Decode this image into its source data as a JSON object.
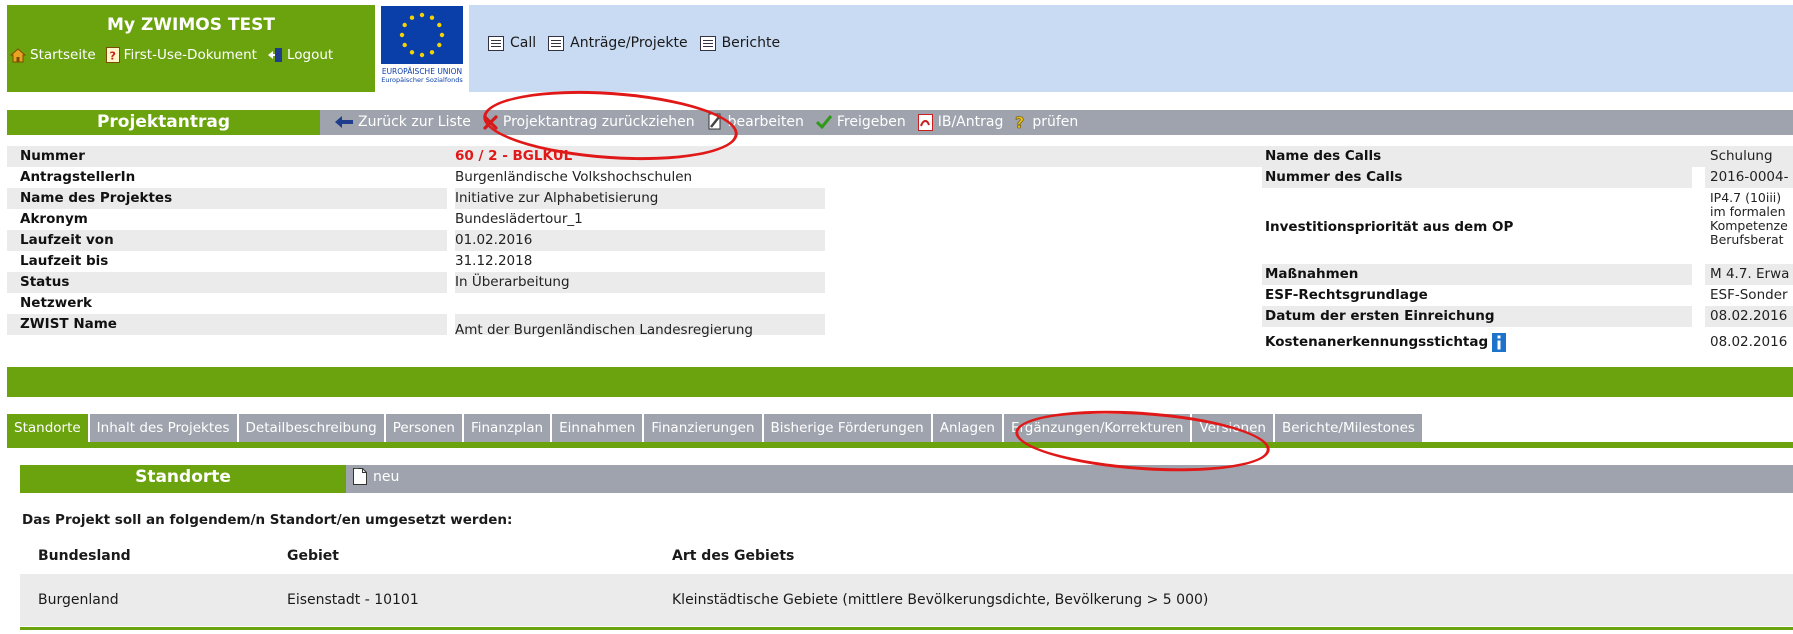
{
  "header": {
    "app_title": "My ZWIMOS TEST",
    "links": [
      {
        "label": "Startseite",
        "icon": "house-icon"
      },
      {
        "label": "First-Use-Dokument",
        "icon": "help-document-icon"
      },
      {
        "label": "Logout",
        "icon": "logout-icon"
      }
    ],
    "eu_logo": {
      "line1": "EUROPÄISCHE UNION",
      "line2": "Europäischer Sozialfonds"
    },
    "menu": [
      {
        "label": "Call",
        "icon": "grid-list-icon"
      },
      {
        "label": "Anträge/Projekte",
        "icon": "grid-list-icon"
      },
      {
        "label": "Berichte",
        "icon": "grid-list-icon"
      }
    ]
  },
  "toolbar": {
    "title": "Projektantrag",
    "actions": [
      {
        "label": "Zurück zur Liste",
        "icon": "back-arrow-icon"
      },
      {
        "label": "Projektantrag zurückziehen",
        "icon": "red-x-icon"
      },
      {
        "label": "bearbeiten",
        "icon": "pencil-icon"
      },
      {
        "label": "Freigeben",
        "icon": "checkmark-icon"
      },
      {
        "label": "IB/Antrag",
        "icon": "pdf-icon"
      },
      {
        "label": "prüfen",
        "icon": "question-icon"
      }
    ]
  },
  "project_info_left": [
    {
      "label": "Nummer",
      "value": "60 / 2 - BGLKUL",
      "highlight": true
    },
    {
      "label": "AntragstellerIn",
      "value": "Burgenländische Volkshochschulen"
    },
    {
      "label": "Name des Projektes",
      "value": "Initiative zur Alphabetisierung"
    },
    {
      "label": "Akronym",
      "value": "Bundeslädertour_1"
    },
    {
      "label": "Laufzeit von",
      "value": "01.02.2016"
    },
    {
      "label": "Laufzeit bis",
      "value": "31.12.2018"
    },
    {
      "label": "Status",
      "value": "In Überarbeitung"
    },
    {
      "label": "Netzwerk",
      "value": ""
    },
    {
      "label": "ZWIST Name",
      "value": "Amt der Burgenländischen Landesregierung"
    }
  ],
  "project_info_right": [
    {
      "label": "Name des Calls",
      "value": "Schulung BÜ"
    },
    {
      "label": "Nummer des Calls",
      "value": "2016-0004-"
    },
    {
      "label": "Investitionspriorität aus dem OP",
      "value_lines": [
        "IP4.7 (10iii)",
        "im formalen",
        "Kompetenze",
        "Berufsberat"
      ]
    },
    {
      "label": "Maßnahmen",
      "value": "M 4.7. Erwa"
    },
    {
      "label": "ESF-Rechtsgrundlage",
      "value": "ESF-Sonder"
    },
    {
      "label": "Datum der ersten Einreichung",
      "value": "08.02.2016"
    },
    {
      "label": "Kostenanerkennungsstichtag",
      "value": "08.02.2016",
      "icon": "info-icon"
    }
  ],
  "tabs": [
    {
      "label": "Standorte",
      "active": true
    },
    {
      "label": "Inhalt des Projektes"
    },
    {
      "label": "Detailbeschreibung"
    },
    {
      "label": "Personen"
    },
    {
      "label": "Finanzplan"
    },
    {
      "label": "Einnahmen"
    },
    {
      "label": "Finanzierungen"
    },
    {
      "label": "Bisherige Förderungen"
    },
    {
      "label": "Anlagen"
    },
    {
      "label": "Ergänzungen/Korrekturen"
    },
    {
      "label": "Versionen"
    },
    {
      "label": "Berichte/Milestones"
    }
  ],
  "standorte": {
    "title": "Standorte",
    "new_label": "neu",
    "intro": "Das Projekt soll an folgendem/n Standort/en umgesetzt werden:",
    "columns": [
      "Bundesland",
      "Gebiet",
      "Art des Gebiets"
    ],
    "rows": [
      [
        "Burgenland",
        "Eisenstadt - 10101",
        "Kleinstädtische Gebiete (mittlere Bevölkerungsdichte, Bevölkerung > 5 000)"
      ]
    ]
  },
  "colors": {
    "brand_green": "#6ba30f",
    "header_blue": "#c9dbf3",
    "bar_gray": "#9ea3ad",
    "annotation_red": "#e01818",
    "highlight_red": "#e01818"
  }
}
